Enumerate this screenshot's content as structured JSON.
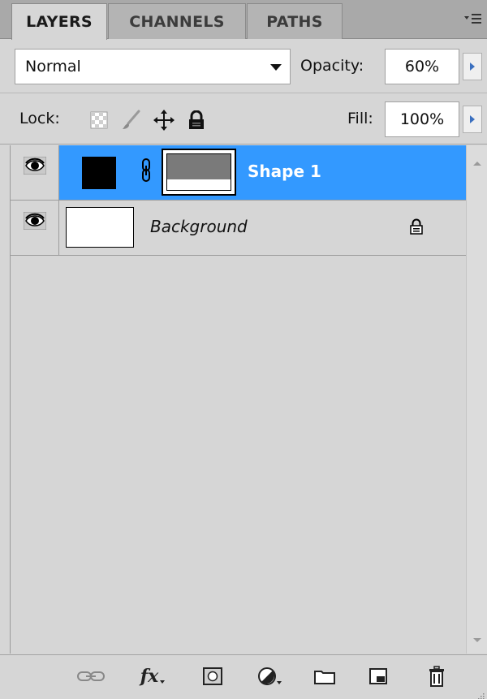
{
  "tabs": [
    {
      "label": "LAYERS",
      "active": true
    },
    {
      "label": "CHANNELS",
      "active": false
    },
    {
      "label": "PATHS",
      "active": false
    }
  ],
  "blend_mode": {
    "value": "Normal"
  },
  "opacity": {
    "label": "Opacity:",
    "value": "60%"
  },
  "lock": {
    "label": "Lock:"
  },
  "fill": {
    "label": "Fill:",
    "value": "100%"
  },
  "layers": [
    {
      "name": "Shape 1",
      "selected": true,
      "visible": true
    },
    {
      "name": "Background",
      "selected": false,
      "visible": true,
      "locked": true
    }
  ],
  "toolbar_icons": [
    "link-layers-icon",
    "fx-icon",
    "add-mask-icon",
    "adjustment-layer-icon",
    "group-folder-icon",
    "new-layer-icon",
    "trash-icon"
  ],
  "colors": {
    "selection": "#3399ff",
    "panel_bg": "#d6d6d6"
  }
}
